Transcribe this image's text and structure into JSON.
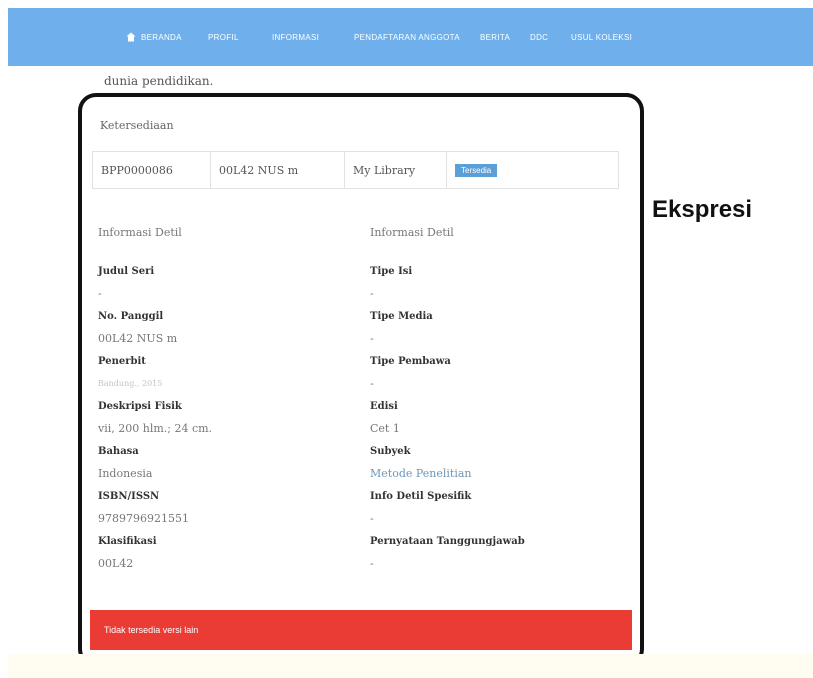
{
  "nav": {
    "items": [
      "BERANDA",
      "PROFIL",
      "INFORMASI",
      "PENDAFTARAN ANGGOTA",
      "BERITA",
      "DDC",
      "USUL KOLEKSI"
    ],
    "home_icon": "home-icon",
    "background": "#6fb0ec"
  },
  "intro_text": "dunia pendidikan.",
  "availability": {
    "heading": "Ketersediaan",
    "row": {
      "item_code": "BPP0000086",
      "call_number": "00L42 NUS m",
      "location": "My Library",
      "status": "Tersedia"
    }
  },
  "details": {
    "left": {
      "heading": "Informasi Detil",
      "fields": [
        {
          "label": "Judul Seri",
          "value": "-"
        },
        {
          "label": "No. Panggil",
          "value": "00L42 NUS m"
        },
        {
          "label": "Penerbit",
          "value": "Bandung., 2015"
        },
        {
          "label": "Deskripsi Fisik",
          "value": "vii, 200 hlm.; 24 cm."
        },
        {
          "label": "Bahasa",
          "value": "Indonesia"
        },
        {
          "label": "ISBN/ISSN",
          "value": "9789796921551"
        },
        {
          "label": "Klasifikasi",
          "value": "00L42"
        }
      ]
    },
    "right": {
      "heading": "Informasi Detil",
      "fields": [
        {
          "label": "Tipe Isi",
          "value": "-"
        },
        {
          "label": "Tipe Media",
          "value": "-"
        },
        {
          "label": "Tipe Pembawa",
          "value": "-"
        },
        {
          "label": "Edisi",
          "value": "Cet 1"
        },
        {
          "label": "Subyek",
          "value": "Metode Penelitian"
        },
        {
          "label": "Info Detil Spesifik",
          "value": "-"
        },
        {
          "label": "Pernyataan Tanggungjawab",
          "value": "-"
        }
      ]
    }
  },
  "alert": {
    "text": "Tidak tersedia versi lain",
    "color": "#ea3b34"
  },
  "side_label": "Ekspresi"
}
